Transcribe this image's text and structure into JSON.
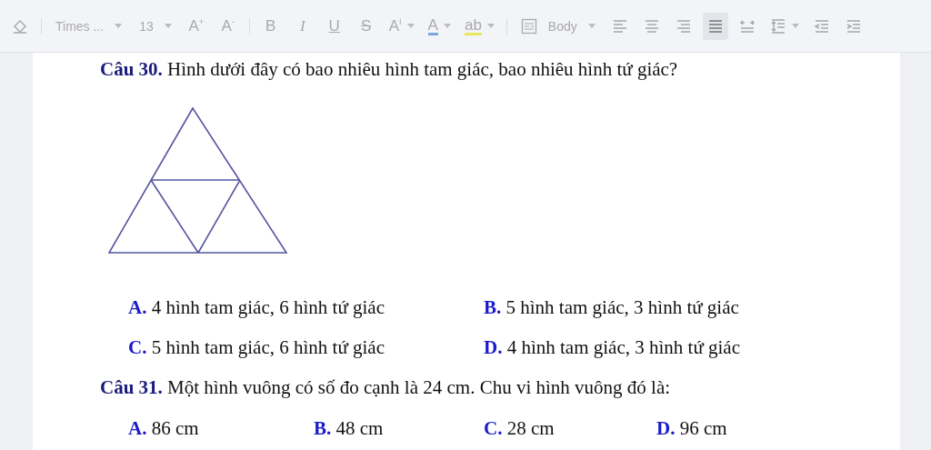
{
  "toolbar": {
    "items": [
      {
        "kind": "icon",
        "selected": false
      },
      {
        "kind": "separator"
      },
      {
        "kind": "dropdown",
        "label": "Times ..."
      },
      {
        "kind": "dropdown",
        "label": "13"
      },
      {
        "kind": "text",
        "label": "A$^{+}$",
        "selected": false
      },
      {
        "kind": "text",
        "label": "A$^{-}$",
        "selected": false
      },
      {
        "kind": "separator"
      },
      {
        "kind": "text",
        "label": "B",
        "selected": false
      },
      {
        "kind": "text",
        "label": "I",
        "selected": false
      },
      {
        "kind": "text",
        "label": "U",
        "selected": false
      },
      {
        "kind": "text",
        "label": "S",
        "selected": false
      },
      {
        "kind": "text",
        "label": "A$^{I}$",
        "selected": false
      },
      {
        "kind": "text",
        "label": "A",
        "selected": false
      },
      {
        "kind": "text",
        "label": "ab",
        "selected": false
      },
      {
        "kind": "separator"
      },
      {
        "kind": "dropdown",
        "label": "Body"
      },
      {
        "kind": "icon",
        "selected": false
      },
      {
        "kind": "icon",
        "selected": false
      },
      {
        "kind": "icon",
        "selected": false
      },
      {
        "kind": "icon",
        "selected": true
      },
      {
        "kind": "icon",
        "selected": false
      },
      {
        "kind": "icon",
        "selected": false
      },
      {
        "kind": "icon",
        "selected": false
      },
      {
        "kind": "icon",
        "selected": false
      }
    ]
  },
  "questions": [
    {
      "prompt": "**Câu 30.** Hình dưới đây có bao nhiêu hình tam giác, bao nhiêu hình tứ giác?",
      "options": [
        "**A.** 4 hình tam giác, 6 hình tứ giác",
        "**B.** 5 hình tam giác, 3 hình tứ giác",
        "**C.** 5 hình tam giác, 6 hình tứ giác",
        "**D.** 4 hình tam giác, 3 hình tứ giác"
      ]
    },
    {
      "prompt": "**Câu 31.** Một hình vuông có số đo cạnh là 24 cm. Chu vi hình vuông đó là:",
      "options": [
        "**A.** 86 cm",
        "**B.** 48 cm",
        "**C.** 28 cm",
        "**D.** 96 cm"
      ]
    }
  ]
}
